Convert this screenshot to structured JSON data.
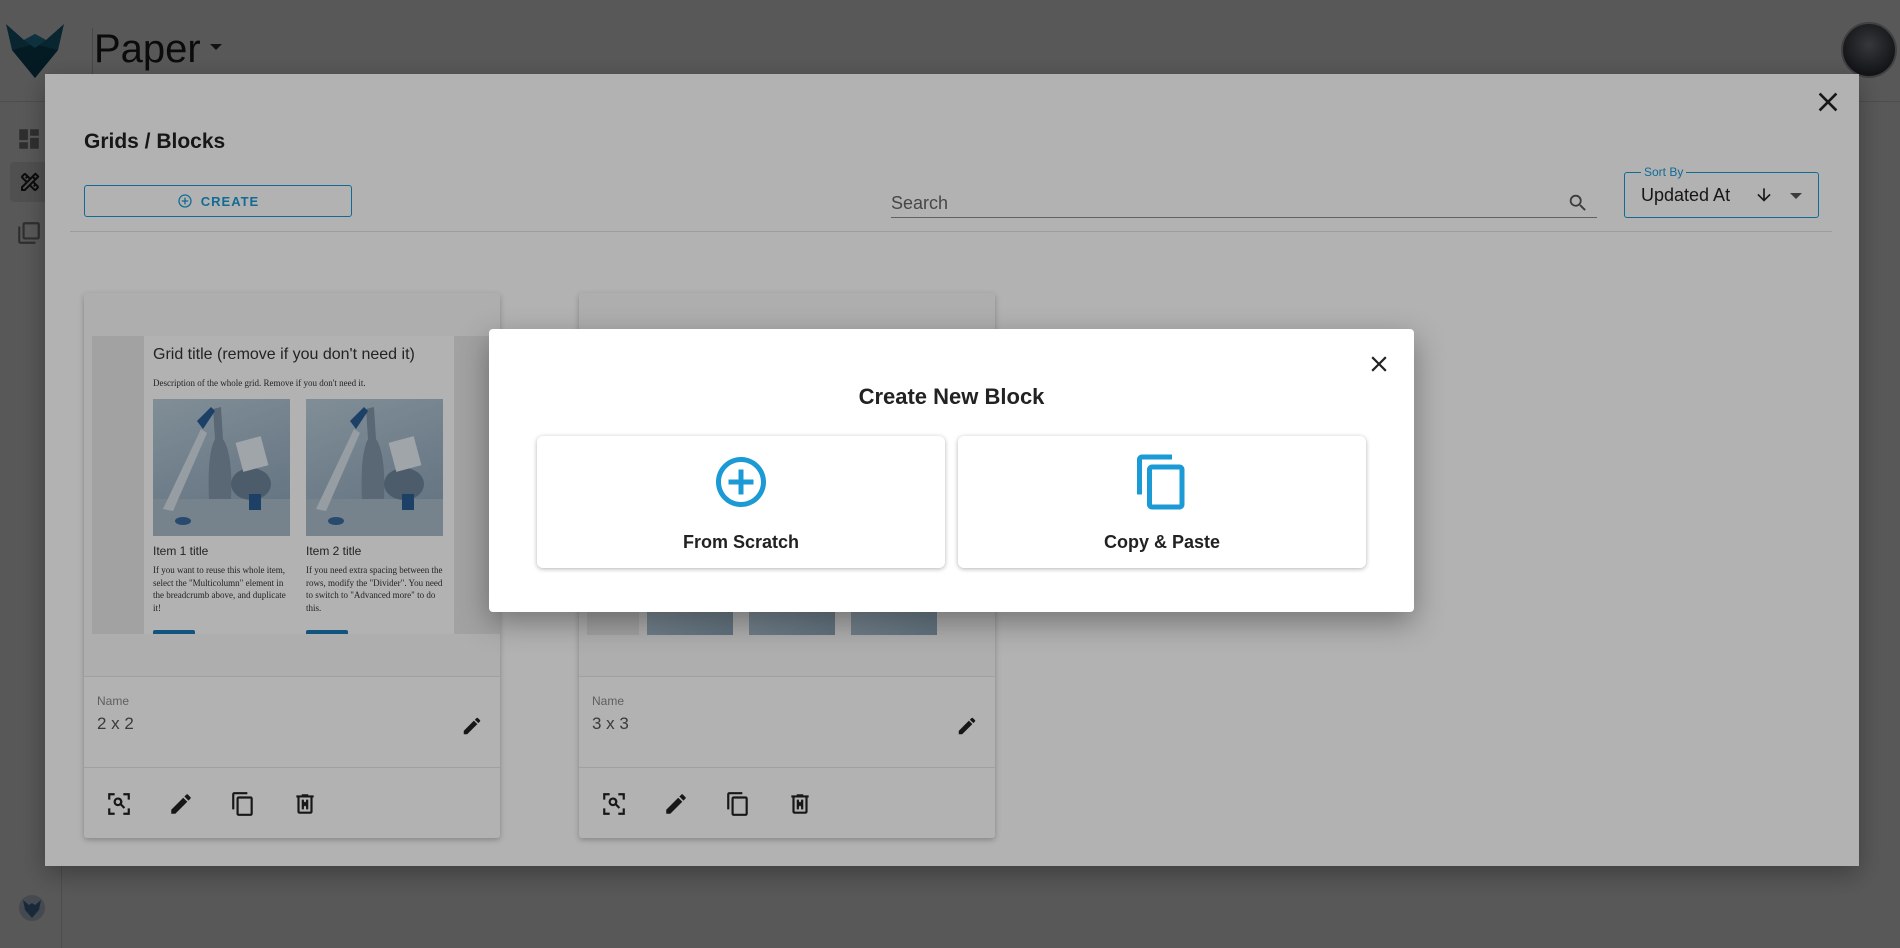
{
  "app": {
    "title": "Paper"
  },
  "library": {
    "title": "Grids / Blocks",
    "create_label": "CREATE",
    "search_placeholder": "Search",
    "sort": {
      "legend": "Sort By",
      "value": "Updated At",
      "direction": "descending"
    }
  },
  "cards": [
    {
      "name_label": "Name",
      "name": "2 x 2",
      "preview": {
        "title": "Grid title (remove if you don't need it)",
        "description": "Description of the whole grid. Remove if you don't need it.",
        "items": [
          {
            "title": "Item 1 title",
            "text": "If you want to reuse this whole item, select the \"Multicolumn\" element in the breadcrumb above, and duplicate it!"
          },
          {
            "title": "Item 2 title",
            "text": "If you need extra spacing between the rows, modify the \"Divider\". You need to switch to \"Advanced more\" to do this."
          }
        ]
      }
    },
    {
      "name_label": "Name",
      "name": "3 x 3"
    }
  ],
  "modal": {
    "title": "Create New Block",
    "options": [
      {
        "label": "From Scratch",
        "icon": "add-circle-icon"
      },
      {
        "label": "Copy & Paste",
        "icon": "copy-icon"
      }
    ]
  },
  "colors": {
    "accent": "#1b9ad6",
    "backdrop": "rgba(0,0,0,0.5)"
  }
}
